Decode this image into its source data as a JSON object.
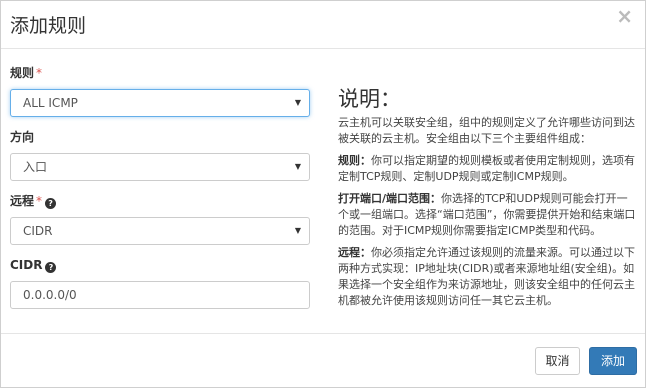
{
  "dialog": {
    "title": "添加规则",
    "close_symbol": "×"
  },
  "form": {
    "rule": {
      "label": "规则",
      "required_mark": "*",
      "value": "ALL ICMP"
    },
    "direction": {
      "label": "方向",
      "value": "入口"
    },
    "remote": {
      "label": "远程",
      "required_mark": "*",
      "value": "CIDR"
    },
    "cidr": {
      "label": "CIDR",
      "value": "0.0.0.0/0"
    }
  },
  "description": {
    "title": "说明：",
    "intro": "云主机可以关联安全组，组中的规则定义了允许哪些访问到达被关联的云主机。安全组由以下三个主要组件组成：",
    "rule_term": "规则：",
    "rule_text": "你可以指定期望的规则模板或者使用定制规则，选项有定制TCP规则、定制UDP规则或定制ICMP规则。",
    "port_term": "打开端口/端口范围：",
    "port_text": "你选择的TCP和UDP规则可能会打开一个或一组端口。选择“端口范围”，你需要提供开始和结束端口的范围。对于ICMP规则你需要指定ICMP类型和代码。",
    "remote_term": "远程：",
    "remote_text": "你必须指定允许通过该规则的流量来源。可以通过以下两种方式实现：IP地址块(CIDR)或者来源地址组(安全组)。如果选择一个安全组作为来访源地址，则该安全组中的任何云主机都被允许使用该规则访问任一其它云主机。"
  },
  "footer": {
    "cancel_label": "取消",
    "add_label": "添加"
  },
  "icons": {
    "help": "question-circle-icon",
    "caret": "caret-down-icon",
    "close": "close-icon"
  },
  "colors": {
    "primary": "#337ab7",
    "required": "#d9534f",
    "focus": "#66afe9"
  }
}
